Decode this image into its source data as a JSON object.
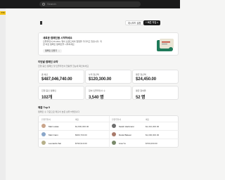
{
  "topbar": {
    "search_placeholder": "Search"
  },
  "sidebar": {
    "yellow_tab": "TTF"
  },
  "header": {
    "btn_light": "대시보드 설정",
    "btn_dark": "+ 빠른 작업 ▾"
  },
  "promo": {
    "title": "새로운 캠페인을 시작하세요",
    "desc": "인플루언서 45,000+ 명이 브랜드와의 협업을 기다리고 있습니다. 지금 바로 캠페인 캠페인을 시작하세요.",
    "link": "캠페인 만들기 →"
  },
  "overview": {
    "title": "이번달 캠페인 요약",
    "desc": "진행 중인 캠페인 및 인플루언서 현황을 한눈에 확인하세요",
    "stats": [
      {
        "label": "총 예산",
        "value": "$487,046,740.00",
        "color": "#1c1c1c"
      },
      {
        "label": "누적 정산액",
        "value": "$120,300.00",
        "color": "#1c1c1c"
      },
      {
        "label": "평균 정산액",
        "value": "$24,450.00",
        "color": "#1c1c1c"
      },
      {
        "label": "진행 중인 캠페인",
        "value": "102개",
        "color": "#1c1c1c"
      },
      {
        "label": "참여 인플루언서 수",
        "value": "3,540 명",
        "color": "#1c1c1c"
      },
      {
        "label": "평균 참여율",
        "value": "52 명",
        "color": "#1c1c1c"
      }
    ]
  },
  "top5": {
    "title": "매출 Top 5",
    "desc": "캠페인 수 기준으로 매출이 높은 상위 5명입니다",
    "headers": [
      "인플루언서",
      "매출",
      "인플루언서",
      "매출"
    ],
    "left": [
      {
        "name": "Mari Lukas",
        "amount": "$1,830,000.00",
        "avatar_color": "#c9a48a"
      },
      {
        "name": "Mari Cann",
        "amount": "$960,700.00",
        "avatar_color": "#8aa6c9"
      },
      {
        "name": "Leonardo Sai",
        "amount": "$790,910.00",
        "avatar_color": "#b7b08a"
      }
    ],
    "right": [
      {
        "name": "Sarah Hartmann",
        "amount": "$1,310,000.00",
        "avatar_color": "#6d6d6d"
      },
      {
        "name": "Dariel Bakesi",
        "amount": "$1,000,000.00",
        "avatar_color": "#a87a6a"
      },
      {
        "name": "Lisa Yu",
        "amount": "$700,000.00",
        "avatar_color": "#7a8a6a"
      }
    ]
  }
}
